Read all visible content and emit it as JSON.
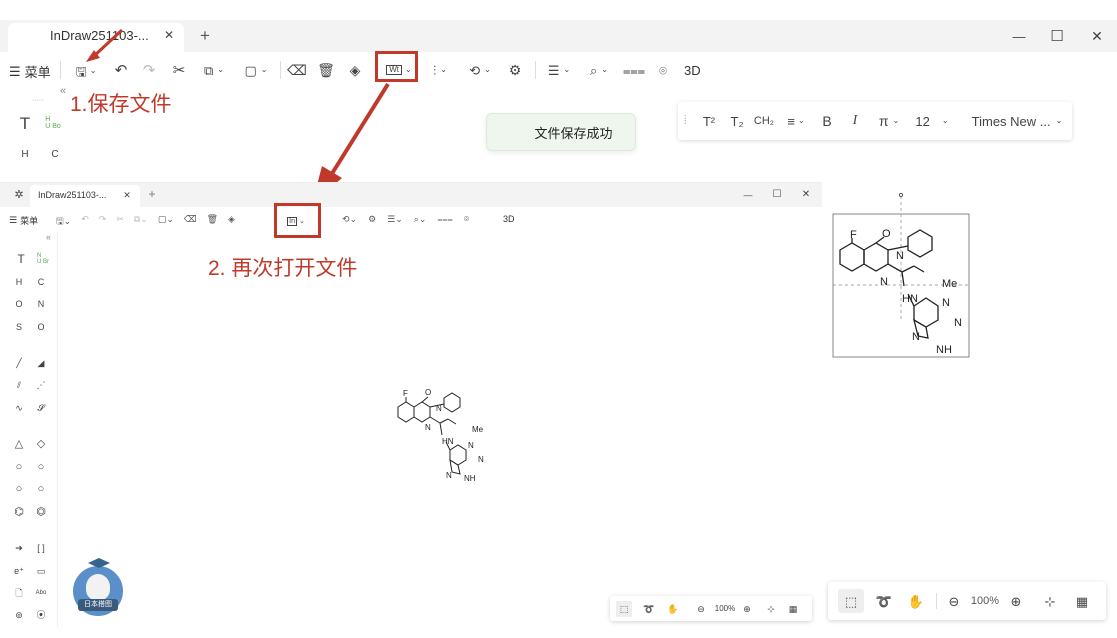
{
  "window": {
    "tab_title": "InDraw251103-...",
    "new_tab": "+",
    "min": "—",
    "max": "☐",
    "close": "✕"
  },
  "toolbar": {
    "menu_label": "菜单",
    "threed": "3D",
    "icons": [
      "save",
      "undo",
      "redo",
      "cut",
      "copy",
      "paste",
      "eraser",
      "delete",
      "fill",
      "template",
      "align",
      "rotate",
      "settings",
      "list",
      "search",
      "text",
      "3d-view"
    ]
  },
  "annotations": {
    "step1": "1.保存文件",
    "step2": "2. 再次打开文件"
  },
  "toast": {
    "message": "文件保存成功"
  },
  "format_bar": {
    "superscript": "T²",
    "subscript": "T₂",
    "chem": "CH₂",
    "bold": "B",
    "italic": "I",
    "symbol": "π",
    "font_size": "12",
    "font_name": "Times New ..."
  },
  "palette": {
    "text": "T",
    "h": "H",
    "c": "C"
  },
  "inner_window": {
    "tab_title": "InDraw251103-...",
    "menu_label": "菜单",
    "threed": "3D",
    "min": "—",
    "max": "☐",
    "close": "✕"
  },
  "inner_palette": {
    "text": "T",
    "atoms": [
      "H",
      "C",
      "O",
      "N",
      "S",
      "O"
    ]
  },
  "molecule": {
    "labels": {
      "F": "F",
      "O": "O",
      "N1": "N",
      "N2": "N",
      "Me": "Me",
      "HN": "HN",
      "Na": "N",
      "Nb": "N",
      "Nc": "N",
      "NH": "NH"
    }
  },
  "zoom_main": {
    "level": "100%"
  },
  "zoom_inner": {
    "level": "100%"
  },
  "logo": {
    "text": "日本搭图"
  }
}
